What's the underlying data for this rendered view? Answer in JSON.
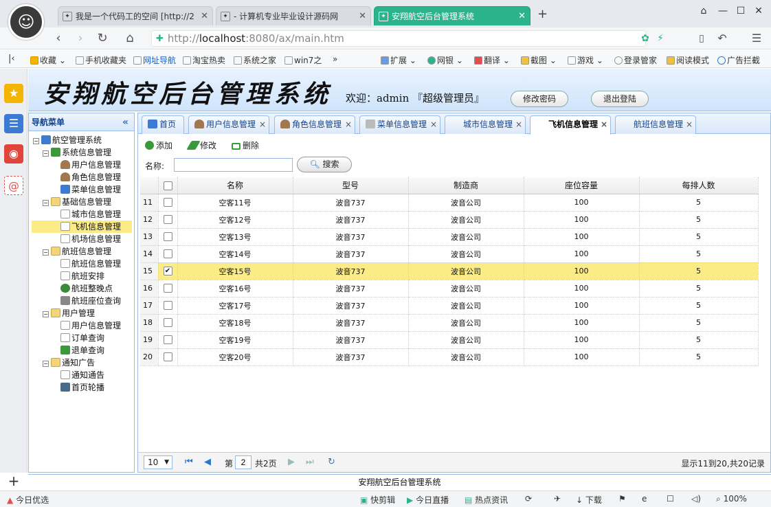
{
  "browser": {
    "tabs": [
      {
        "label": "我是一个代码工的空间 [http://2",
        "favicon": "paw-icon"
      },
      {
        "label": "- 计算机专业毕业设计源码网",
        "favicon": "paw-icon"
      },
      {
        "label": "安翔航空后台管理系统",
        "favicon": "paw-icon",
        "active": true
      }
    ],
    "new_tab": "+",
    "url_scheme": "http://",
    "url_host": "localhost",
    "url_rest": ":8080/ax/main.htm",
    "bookmarks": [
      "收藏",
      "手机收藏夹",
      "网址导航",
      "淘宝热卖",
      "系统之家",
      "win7之",
      "»",
      "扩展",
      "网银",
      "翻译",
      "截图",
      "游戏",
      "登录管家",
      "阅读模式",
      "广告拦截"
    ],
    "status_left": "今日优选",
    "status_items": [
      "快剪辑",
      "今日直播",
      "热点资讯",
      "下载",
      "100%"
    ]
  },
  "header": {
    "title": "安翔航空后台管理系统",
    "welcome": "欢迎：admin 『超级管理员』",
    "change_password": "修改密码",
    "logout": "退出登陆"
  },
  "nav": {
    "title": "导航菜单",
    "collapse": "«",
    "tree": [
      {
        "label": "航空管理系统",
        "level": 0,
        "icon": "network-icon",
        "toggle": "−"
      },
      {
        "label": "系统信息管理",
        "level": 1,
        "icon": "box-icon",
        "toggle": "−"
      },
      {
        "label": "用户信息管理",
        "level": 2,
        "icon": "user-icon"
      },
      {
        "label": "角色信息管理",
        "level": 2,
        "icon": "user-icon"
      },
      {
        "label": "菜单信息管理",
        "level": 2,
        "icon": "network-icon"
      },
      {
        "label": "基础信息管理",
        "level": 1,
        "icon": "folder-icon",
        "toggle": "−"
      },
      {
        "label": "城市信息管理",
        "level": 2,
        "icon": "document-icon"
      },
      {
        "label": "飞机信息管理",
        "level": 2,
        "icon": "document-icon",
        "selected": true
      },
      {
        "label": "机场信息管理",
        "level": 2,
        "icon": "document-icon"
      },
      {
        "label": "航班信息管理",
        "level": 1,
        "icon": "folder-icon",
        "toggle": "−"
      },
      {
        "label": "航班信息管理",
        "level": 2,
        "icon": "document-icon"
      },
      {
        "label": "航班安排",
        "level": 2,
        "icon": "document-icon"
      },
      {
        "label": "航班整晚点",
        "level": 2,
        "icon": "clock-icon"
      },
      {
        "label": "航班座位查询",
        "level": 2,
        "icon": "tools-icon"
      },
      {
        "label": "用户管理",
        "level": 1,
        "icon": "folder-icon",
        "toggle": "−"
      },
      {
        "label": "用户信息管理",
        "level": 2,
        "icon": "document-icon"
      },
      {
        "label": "订单查询",
        "level": 2,
        "icon": "document-icon"
      },
      {
        "label": "退单查询",
        "level": 2,
        "icon": "box-icon"
      },
      {
        "label": "通知广告",
        "level": 1,
        "icon": "folder-icon",
        "toggle": "−"
      },
      {
        "label": "通知通告",
        "level": 2,
        "icon": "document-icon"
      },
      {
        "label": "首页轮播",
        "level": 2,
        "icon": "image-icon"
      }
    ]
  },
  "main": {
    "tabs": [
      {
        "label": "首页",
        "icon": "home-icon",
        "closable": false
      },
      {
        "label": "用户信息管理",
        "icon": "user-icon",
        "closable": true
      },
      {
        "label": "角色信息管理",
        "icon": "user-icon",
        "closable": true
      },
      {
        "label": "菜单信息管理",
        "icon": "network-icon",
        "closable": true
      },
      {
        "label": "城市信息管理",
        "icon": "",
        "closable": true
      },
      {
        "label": "飞机信息管理",
        "icon": "",
        "closable": true,
        "active": true
      },
      {
        "label": "航班信息管理",
        "icon": "",
        "closable": true
      }
    ],
    "toolbar": {
      "add": "添加",
      "edit": "修改",
      "delete": "删除"
    },
    "search": {
      "label": "名称:",
      "value": "",
      "button": "搜索"
    },
    "grid": {
      "columns": [
        "名称",
        "型号",
        "制造商",
        "座位容量",
        "每排人数"
      ],
      "rows": [
        {
          "num": "11",
          "name": "空客11号",
          "model": "波音737",
          "maker": "波音公司",
          "seats": "100",
          "per_row": "5",
          "checked": false
        },
        {
          "num": "12",
          "name": "空客12号",
          "model": "波音737",
          "maker": "波音公司",
          "seats": "100",
          "per_row": "5",
          "checked": false
        },
        {
          "num": "13",
          "name": "空客13号",
          "model": "波音737",
          "maker": "波音公司",
          "seats": "100",
          "per_row": "5",
          "checked": false
        },
        {
          "num": "14",
          "name": "空客14号",
          "model": "波音737",
          "maker": "波音公司",
          "seats": "100",
          "per_row": "5",
          "checked": false
        },
        {
          "num": "15",
          "name": "空客15号",
          "model": "波音737",
          "maker": "波音公司",
          "seats": "100",
          "per_row": "5",
          "checked": true
        },
        {
          "num": "16",
          "name": "空客16号",
          "model": "波音737",
          "maker": "波音公司",
          "seats": "100",
          "per_row": "5",
          "checked": false
        },
        {
          "num": "17",
          "name": "空客17号",
          "model": "波音737",
          "maker": "波音公司",
          "seats": "100",
          "per_row": "5",
          "checked": false
        },
        {
          "num": "18",
          "name": "空客18号",
          "model": "波音737",
          "maker": "波音公司",
          "seats": "100",
          "per_row": "5",
          "checked": false
        },
        {
          "num": "19",
          "name": "空客19号",
          "model": "波音737",
          "maker": "波音公司",
          "seats": "100",
          "per_row": "5",
          "checked": false
        },
        {
          "num": "20",
          "name": "空客20号",
          "model": "波音737",
          "maker": "波音公司",
          "seats": "100",
          "per_row": "5",
          "checked": false
        }
      ]
    },
    "pager": {
      "page_size": "10",
      "page_prefix": "第",
      "page": "2",
      "page_total": "共2页",
      "summary": "显示11到20,共20记录"
    }
  },
  "footer": "安翔航空后台管理系统",
  "colors": {
    "accent": "#2bb38c",
    "selected_row": "#fbec88",
    "panel_border": "#99bbe8"
  }
}
